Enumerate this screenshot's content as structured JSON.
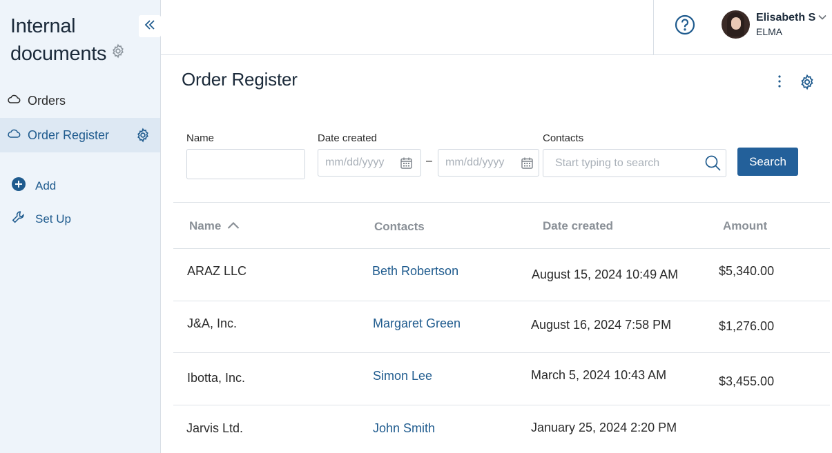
{
  "app": {
    "section_title": "Internal documents",
    "sidebar": {
      "items": [
        {
          "label": "Orders",
          "icon": "cloud-icon",
          "active": false
        },
        {
          "label": "Order Register",
          "icon": "cloud-icon",
          "active": true
        }
      ],
      "actions": [
        {
          "label": "Add",
          "icon": "plus-circle-icon"
        },
        {
          "label": "Set Up",
          "icon": "wrench-icon"
        }
      ]
    }
  },
  "header": {
    "user_name": "Elisabeth S",
    "user_org": "ELMA"
  },
  "page": {
    "title": "Order Register"
  },
  "filters": {
    "name_label": "Name",
    "name_value": "",
    "date_label": "Date created",
    "date_from_placeholder": "mm/dd/yyyy",
    "date_separator": "–",
    "date_to_placeholder": "mm/dd/yyyy",
    "contacts_label": "Contacts",
    "contacts_placeholder": "Start typing to search",
    "search_label": "Search"
  },
  "table": {
    "columns": [
      "Name",
      "Contacts",
      "Date created",
      "Amount"
    ],
    "sorted_by": "Name",
    "sort_direction": "ascending",
    "rows": [
      {
        "name": "ARAZ LLC",
        "contact": "Beth Robertson",
        "date": "August 15, 2024 10:49 AM",
        "amount": "$5,340.00"
      },
      {
        "name": "J&A, Inc.",
        "contact": "Margaret Green",
        "date": "August 16, 2024 7:58 PM",
        "amount": "$1,276.00"
      },
      {
        "name": "Ibotta, Inc.",
        "contact": "Simon Lee",
        "date": "March 5, 2024 10:43 AM",
        "amount": "$3,455.00"
      },
      {
        "name": "Jarvis Ltd.",
        "contact": "John Smith",
        "date": "January 25, 2024 2:20 PM",
        "amount": ""
      }
    ]
  },
  "colors": {
    "accent": "#23609a",
    "link": "#1f5b8e",
    "sidebar_bg": "#eef4fa",
    "sidebar_active_bg": "#dde8f3"
  }
}
